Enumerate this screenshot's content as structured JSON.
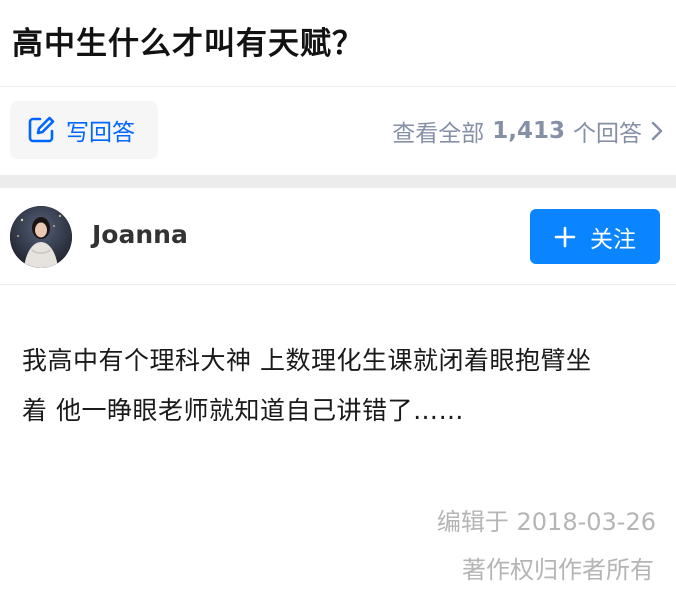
{
  "question": {
    "title": "高中生什么才叫有天赋？"
  },
  "actions": {
    "write_answer_label": "写回答",
    "view_all_prefix": "查看全部",
    "answer_count": "1,413",
    "view_all_suffix": "个回答"
  },
  "author": {
    "name": "Joanna",
    "follow_label": "关注"
  },
  "answer": {
    "lines": [
      "我高中有个理科大神 上数理化生课就闭着眼抱臂坐",
      "着 他一睁眼老师就知道自己讲错了……"
    ],
    "edited": "编辑于 2018-03-26",
    "copyright": "著作权归作者所有"
  },
  "colors": {
    "accent": "#0066ff",
    "follow_bg": "#0b84ff",
    "muted": "#8590a6",
    "meta": "#b5b5b5"
  },
  "icons": {
    "write": "edit-icon",
    "chevron": "chevron-right-icon",
    "plus": "plus-icon"
  }
}
